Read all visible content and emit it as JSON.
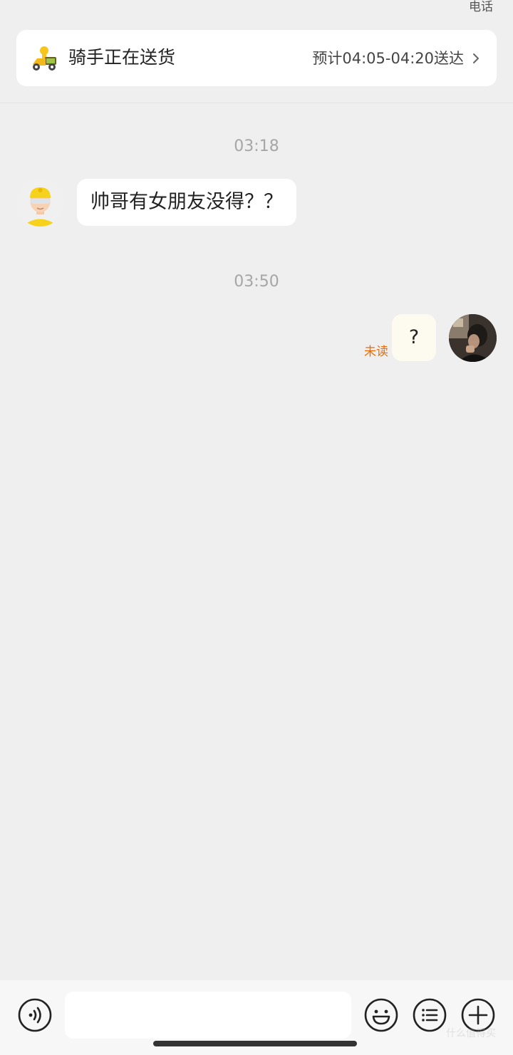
{
  "header": {
    "phone_link": "电话"
  },
  "delivery_status": {
    "title": "骑手正在送货",
    "eta": "预计04:05-04:20送达",
    "icon": "delivery-rider-icon"
  },
  "conversation": [
    {
      "timestamp": "03:18",
      "sender": "rider",
      "text": "帅哥有女朋友没得？？"
    },
    {
      "timestamp": "03:50",
      "sender": "me",
      "text": "?",
      "read_status": "未读"
    }
  ],
  "input_bar": {
    "voice_icon": "voice-icon",
    "input_value": "",
    "emoji_icon": "emoji-icon",
    "quick_reply_icon": "quick-reply-icon",
    "more_icon": "plus-icon"
  },
  "colors": {
    "background": "#efefef",
    "unread": "#f06a00",
    "my_bubble": "#fdfaf0",
    "rider_yellow": "#f7d21c"
  },
  "watermark": "什么值得买"
}
